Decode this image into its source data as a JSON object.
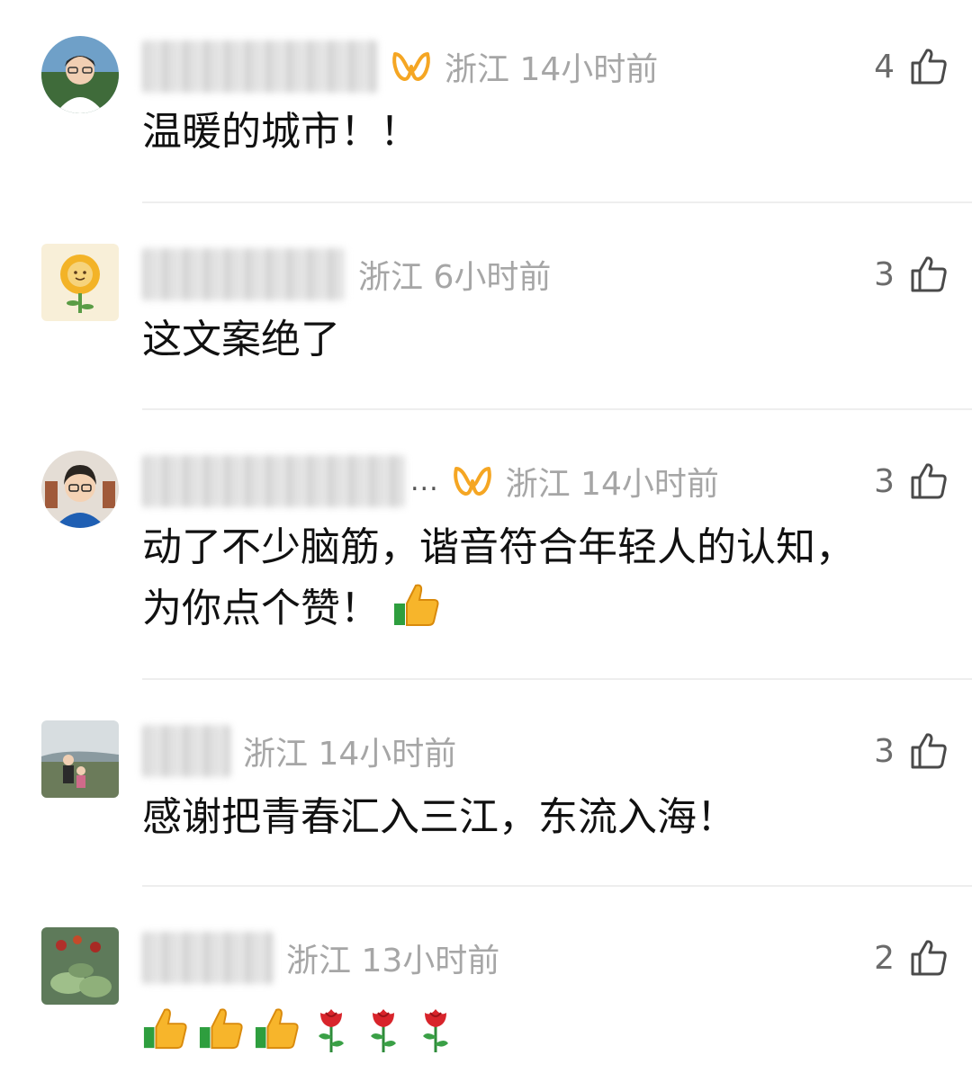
{
  "comments": [
    {
      "location_time": "浙江 14小时前",
      "likes": "4",
      "text": "温暖的城市！！",
      "has_vip_badge": true,
      "nickname_ellipsis": ""
    },
    {
      "location_time": "浙江 6小时前",
      "likes": "3",
      "text": "这文案绝了",
      "has_vip_badge": false,
      "nickname_ellipsis": ""
    },
    {
      "location_time": "浙江 14小时前",
      "likes": "3",
      "text_line1": "动了不少脑筋，谐音符合年轻人的认知，",
      "text_line2": "为你点个赞！",
      "has_vip_badge": true,
      "nickname_ellipsis": "..."
    },
    {
      "location_time": "浙江 14小时前",
      "likes": "3",
      "text": "感谢把青春汇入三江，东流入海！",
      "has_vip_badge": false,
      "nickname_ellipsis": ""
    },
    {
      "location_time": "浙江 13小时前",
      "likes": "2",
      "emojis": [
        "thumbs-up",
        "thumbs-up",
        "thumbs-up",
        "rose",
        "rose",
        "rose"
      ],
      "has_vip_badge": false,
      "nickname_ellipsis": ""
    }
  ],
  "icons": {
    "like": "thumbs-up-outline-icon",
    "vip": "vip-badge-icon"
  },
  "colors": {
    "vip_orange": "#f5a623",
    "meta_gray": "#a6a6a6",
    "divider": "#eeeeee"
  }
}
